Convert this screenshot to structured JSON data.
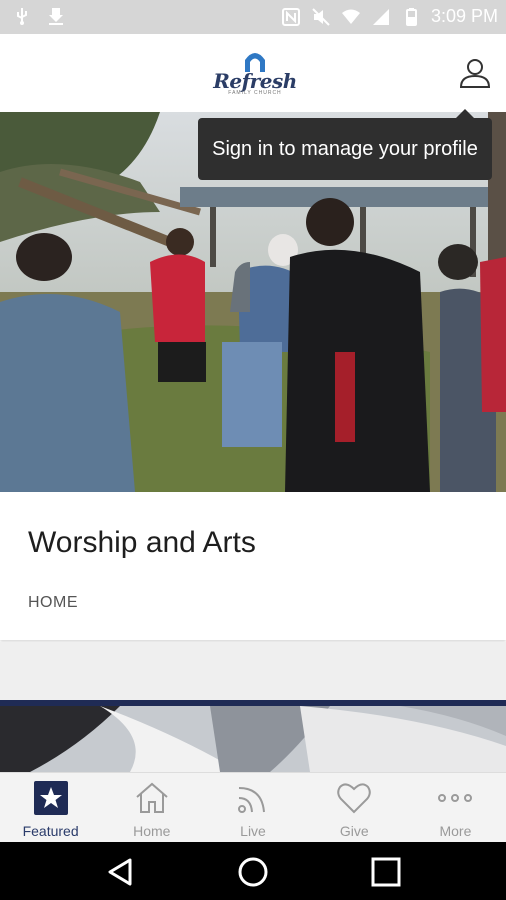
{
  "status_bar": {
    "time": "3:09 PM"
  },
  "header": {
    "logo_text": "Refresh",
    "logo_subtext": "FAMILY CHURCH",
    "accent": "#2b3d66"
  },
  "tooltip": {
    "text": "Sign in to manage your profile"
  },
  "card": {
    "title": "Worship and Arts",
    "category": "HOME"
  },
  "tabs": [
    {
      "label": "Featured",
      "icon": "star-icon",
      "active": true
    },
    {
      "label": "Home",
      "icon": "home-icon",
      "active": false
    },
    {
      "label": "Live",
      "icon": "rss-icon",
      "active": false
    },
    {
      "label": "Give",
      "icon": "heart-icon",
      "active": false
    },
    {
      "label": "More",
      "icon": "more-dots-icon",
      "active": false
    }
  ]
}
